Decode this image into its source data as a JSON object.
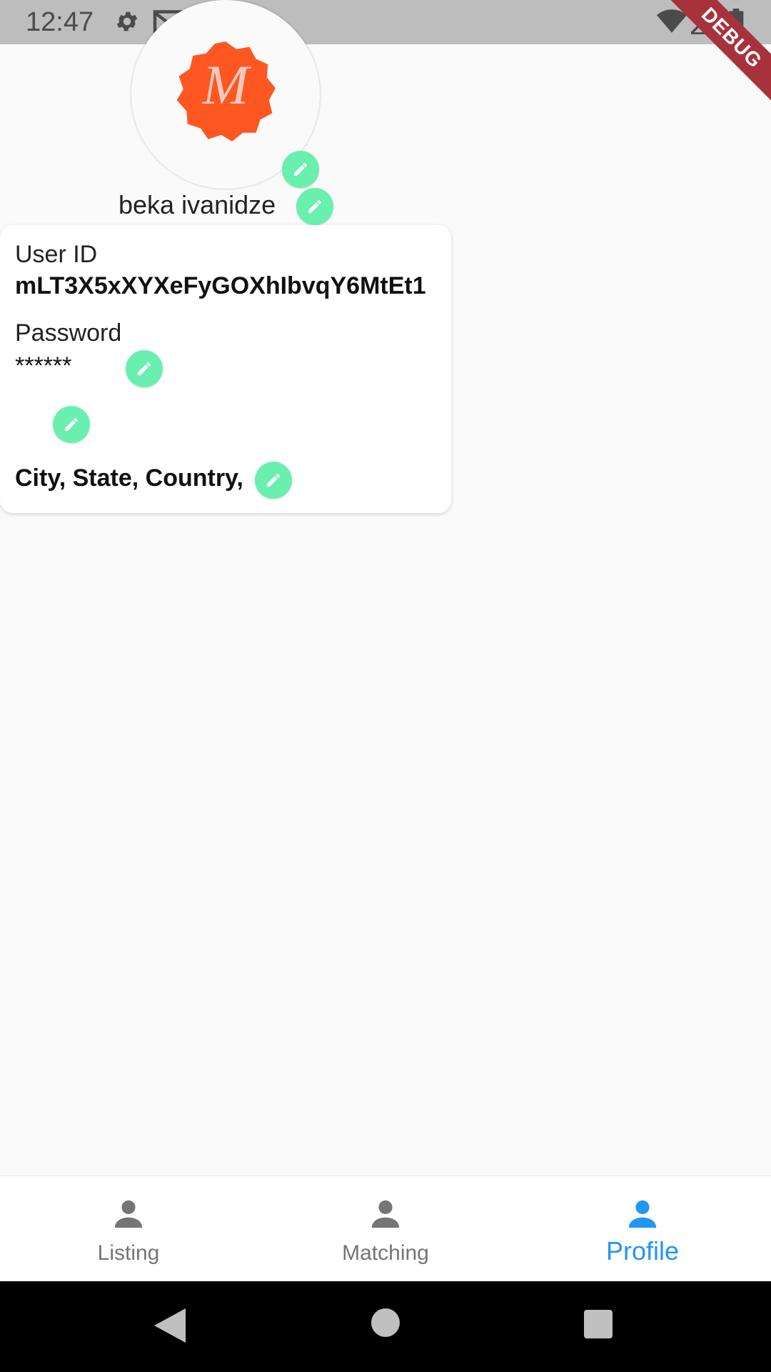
{
  "status_bar": {
    "time": "12:47",
    "left_icons": [
      "gear-icon",
      "gmail-icon",
      "google-icon",
      "sd-card-icon"
    ],
    "right_icons": [
      "wifi-icon",
      "signal-icon",
      "battery-icon"
    ]
  },
  "debug_banner": {
    "label": "DEBUG"
  },
  "profile": {
    "avatar_letter": "M",
    "avatar_color": "#ff5722",
    "name": "beka ivanidze",
    "user_id_label": "User ID",
    "user_id": "mLT3X5xXYXeFyGOXhIbvqY6MtEt1",
    "password_label": "Password",
    "password": "******",
    "location": "City, State, Country,"
  },
  "colors": {
    "edit_button": "#69f0ae",
    "nav_active": "#2196f3",
    "nav_inactive": "#757575"
  },
  "bottom_nav": {
    "items": [
      {
        "label": "Listing",
        "icon": "person-icon",
        "active": false
      },
      {
        "label": "Matching",
        "icon": "person-icon",
        "active": false
      },
      {
        "label": "Profile",
        "icon": "person-icon",
        "active": true
      }
    ]
  },
  "system_nav": [
    "back-icon",
    "home-icon",
    "recents-icon"
  ]
}
